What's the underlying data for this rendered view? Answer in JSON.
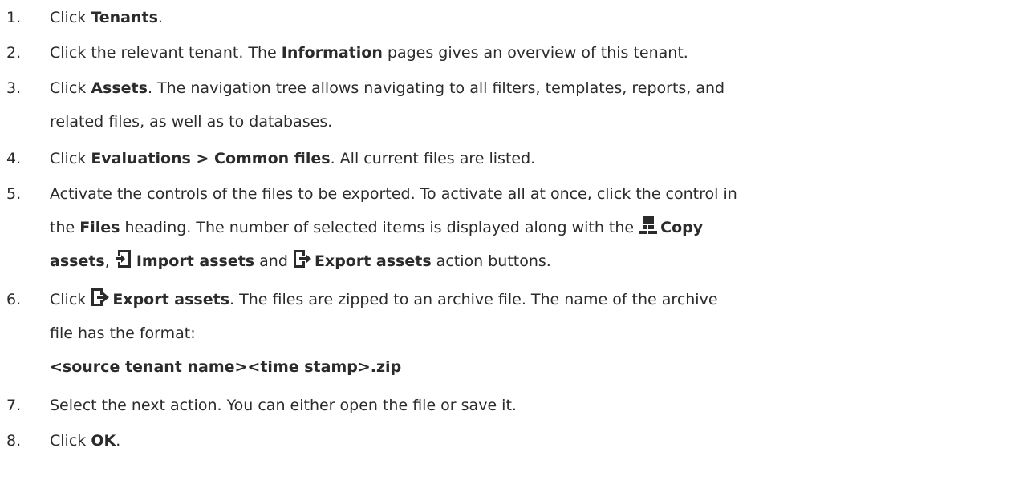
{
  "steps": [
    {
      "number": "1.",
      "prefix": "Click ",
      "bold": "Tenants",
      "suffix": "."
    },
    {
      "number": "2.",
      "prefix": "Click the relevant tenant. The ",
      "bold": "Information",
      "suffix": " pages gives an overview of this tenant."
    },
    {
      "number": "3.",
      "prefix": "Click ",
      "bold": "Assets",
      "suffix_line1": ". The navigation tree allows navigating to all filters, templates, reports, and",
      "line2": "related files, as well as to databases."
    },
    {
      "number": "4.",
      "prefix": "Click ",
      "bold": "Evaluations > Common files",
      "suffix": ". All current files are listed."
    },
    {
      "number": "5.",
      "line1": "Activate the controls of the files to be exported. To activate all at once, click the control in",
      "line2_prefix": "the ",
      "line2_bold": "Files",
      "line2_mid": " heading. The number of selected items is displayed along with the ",
      "copy_bold_a": "Copy",
      "copy_bold_b": "assets",
      "sep1": ", ",
      "import_bold": "Import assets",
      "sep2": " and ",
      "export_bold": "Export assets",
      "line3_suffix": " action buttons."
    },
    {
      "number": "6.",
      "prefix": "Click ",
      "export_bold": "Export assets",
      "suffix_line1": ". The files are zipped to an archive file. The name of the archive",
      "line2": "file has the format:",
      "format": "<source tenant name><time stamp>.zip"
    },
    {
      "number": "7.",
      "text": "Select the next action. You can either open the file or save it."
    },
    {
      "number": "8.",
      "prefix": "Click ",
      "bold": "OK",
      "suffix": "."
    }
  ],
  "icons": {
    "copy": "copy-assets-icon",
    "import": "import-assets-icon",
    "export": "export-assets-icon"
  },
  "colors": {
    "text": "#2b2b2b",
    "icon": "#2b2b2b"
  }
}
